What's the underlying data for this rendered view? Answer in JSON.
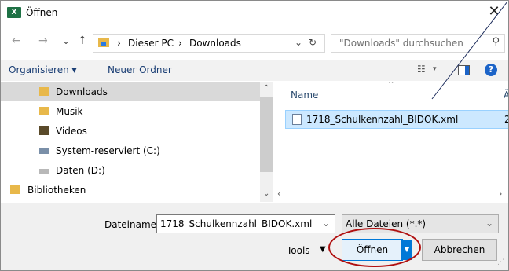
{
  "window": {
    "title": "Öffnen",
    "app_icon_text": "X"
  },
  "nav": {
    "back": "←",
    "forward": "→",
    "recent": "⌄",
    "up": "↑",
    "breadcrumb": [
      "Dieser PC",
      "Downloads"
    ],
    "separator": "›",
    "dropdown": "⌄",
    "refresh": "↻",
    "search_placeholder": "\"Downloads\" durchsuchen"
  },
  "toolbar": {
    "organize": "Organisieren ▾",
    "new_folder": "Neuer Ordner",
    "help": "?"
  },
  "tree": {
    "items": [
      {
        "label": "Downloads",
        "icon": "downloads-folder-icon",
        "selected": true
      },
      {
        "label": "Musik",
        "icon": "music-folder-icon"
      },
      {
        "label": "Videos",
        "icon": "videos-folder-icon"
      },
      {
        "label": "System-reserviert (C:)",
        "icon": "drive-icon"
      },
      {
        "label": "Daten (D:)",
        "icon": "drive-icon"
      },
      {
        "label": "Bibliotheken",
        "icon": "libraries-icon"
      }
    ]
  },
  "files": {
    "column_name": "Name",
    "column_next": "Ä",
    "rows": [
      {
        "name": "1718_Schulkennzahl_BIDOK.xml",
        "date_partial": "2"
      }
    ]
  },
  "bottom": {
    "filename_label": "Dateiname:",
    "filename_value": "1718_Schulkennzahl_BIDOK.xml",
    "filetype_value": "Alle Dateien (*.*)",
    "tools_label": "Tools",
    "open_label": "Öffnen",
    "cancel_label": "Abbrechen"
  },
  "annotation_color": "#b01010"
}
